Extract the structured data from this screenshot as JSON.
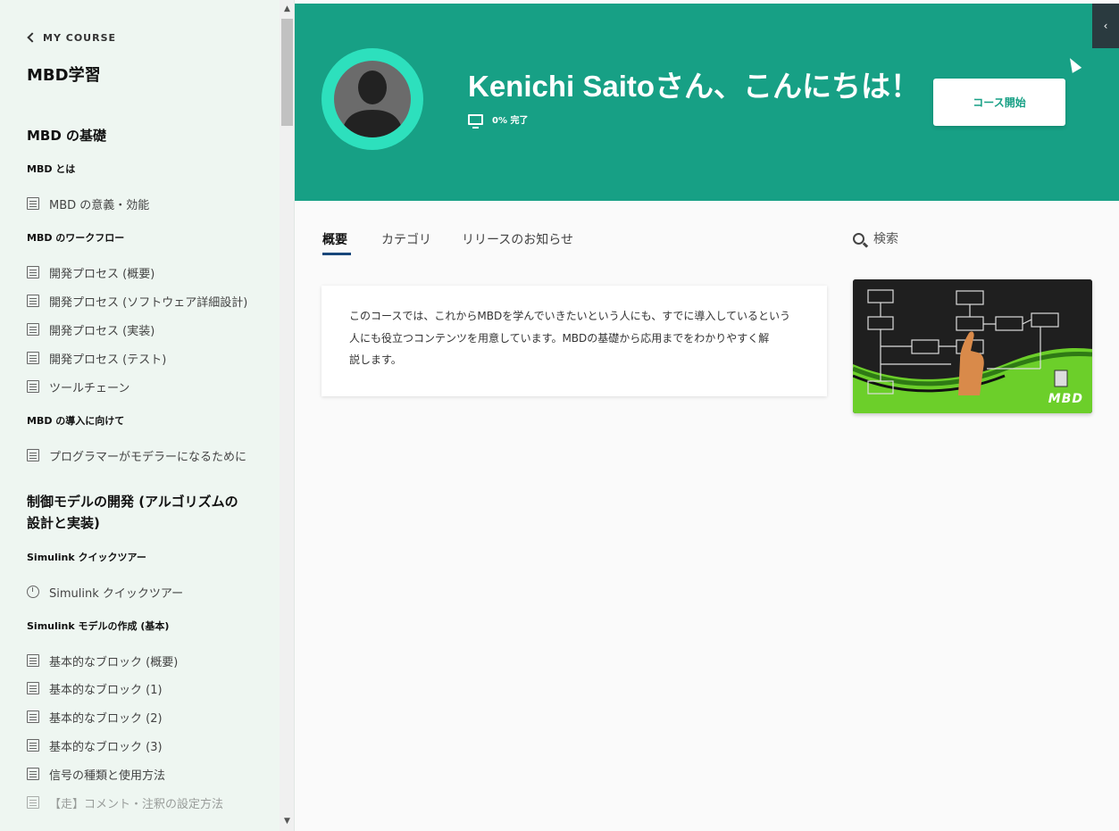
{
  "sidebar": {
    "back_label": "MY COURSE",
    "course_title": "MBD学習",
    "sections": [
      {
        "title": "MBD の基礎",
        "groups": [
          {
            "title": "MBD とは",
            "lessons": [
              "MBD の意義・効能"
            ]
          },
          {
            "title": "MBD のワークフロー",
            "lessons": [
              "開発プロセス (概要)",
              "開発プロセス (ソフトウェア詳細設計)",
              "開発プロセス (実装)",
              "開発プロセス (テスト)",
              "ツールチェーン"
            ]
          },
          {
            "title": "MBD の導入に向けて",
            "lessons": [
              "プログラマーがモデラーになるために"
            ]
          }
        ]
      },
      {
        "title": "制御モデルの開発 (アルゴリズムの設計と実装)",
        "groups": [
          {
            "title": "Simulink クイックツアー",
            "lessons": [
              "Simulink クイックツアー"
            ]
          },
          {
            "title": "Simulink モデルの作成 (基本)",
            "lessons": [
              "基本的なブロック (概要)",
              "基本的なブロック (1)",
              "基本的なブロック (2)",
              "基本的なブロック (3)",
              "信号の種類と使用方法",
              "【走】コメント・注釈の設定方法"
            ]
          }
        ]
      }
    ]
  },
  "header": {
    "greeting": "Kenichi Saitoさん、こんにちは！",
    "progress_text": "0% 完了",
    "progress_percent": 0,
    "start_button": "コース開始",
    "collapse_icon": "‹",
    "accent_color": "#17a085"
  },
  "tabs": [
    "概要",
    "カテゴリ",
    "リリースのお知らせ"
  ],
  "search": {
    "label": "検索"
  },
  "overview": {
    "text_line1": "このコースでは、これからMBDを学んでいきたいという人にも、すでに導入しているという",
    "text_line2": "人にも役立つコンテンツを用意しています。MBDの基礎から応用までをわかりやすく解",
    "text_line3": "説します。"
  },
  "course_image": {
    "label": "MBD"
  }
}
